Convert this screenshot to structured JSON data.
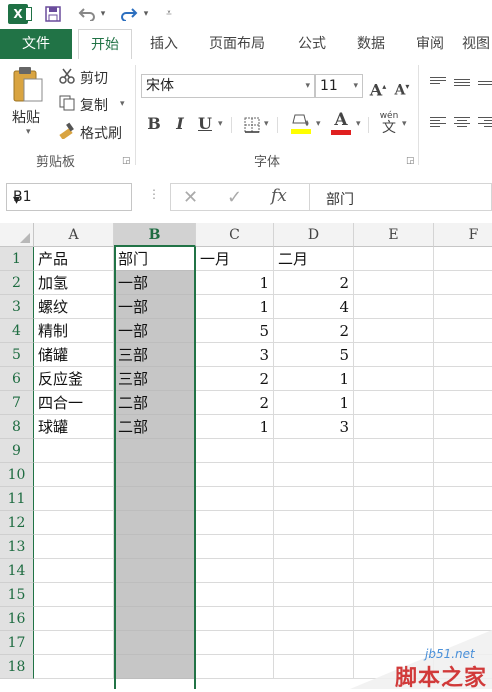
{
  "qat": {
    "logo_letter": "X",
    "save_icon": "save-icon",
    "undo_icon": "undo-icon",
    "redo_icon": "redo-icon"
  },
  "tabs": [
    {
      "label": "文件"
    },
    {
      "label": "开始"
    },
    {
      "label": "插入"
    },
    {
      "label": "页面布局"
    },
    {
      "label": "公式"
    },
    {
      "label": "数据"
    },
    {
      "label": "审阅"
    },
    {
      "label": "视图"
    }
  ],
  "ribbon": {
    "clipboard": {
      "paste": "粘贴",
      "cut": "剪切",
      "copy": "复制",
      "format_painter": "格式刷",
      "group_label": "剪贴板"
    },
    "font": {
      "font_name": "宋体",
      "font_size": "11",
      "bold": "B",
      "italic": "I",
      "underline": "U",
      "grow": "A",
      "shrink": "A",
      "phonetic": "wén",
      "phonetic_sub": "文",
      "font_color_letter": "A",
      "group_label": "字体"
    },
    "colors": {
      "accent": "#217346",
      "fill": "#ffff00",
      "font_color": "#e02020"
    }
  },
  "formula_bar": {
    "name_box": "B1",
    "fx": "fx",
    "content": "部门"
  },
  "sheet": {
    "columns": [
      "A",
      "B",
      "C",
      "D",
      "E",
      "F"
    ],
    "selected_column": "B",
    "row_numbers": [
      "1",
      "2",
      "3",
      "4",
      "5",
      "6",
      "7",
      "8",
      "9",
      "10",
      "11",
      "12",
      "13",
      "14",
      "15",
      "16",
      "17",
      "18"
    ],
    "rows": [
      [
        "产品",
        "部门",
        "一月",
        "二月"
      ],
      [
        "加氢",
        "一部",
        "1",
        "2"
      ],
      [
        "螺纹",
        "一部",
        "1",
        "4"
      ],
      [
        "精制",
        "一部",
        "5",
        "2"
      ],
      [
        "储罐",
        "三部",
        "3",
        "5"
      ],
      [
        "反应釜",
        "三部",
        "2",
        "1"
      ],
      [
        "四合一",
        "二部",
        "2",
        "1"
      ],
      [
        "球罐",
        "二部",
        "1",
        "3"
      ]
    ]
  },
  "watermark": {
    "url": "jb51.net",
    "text": "脚本之家"
  }
}
